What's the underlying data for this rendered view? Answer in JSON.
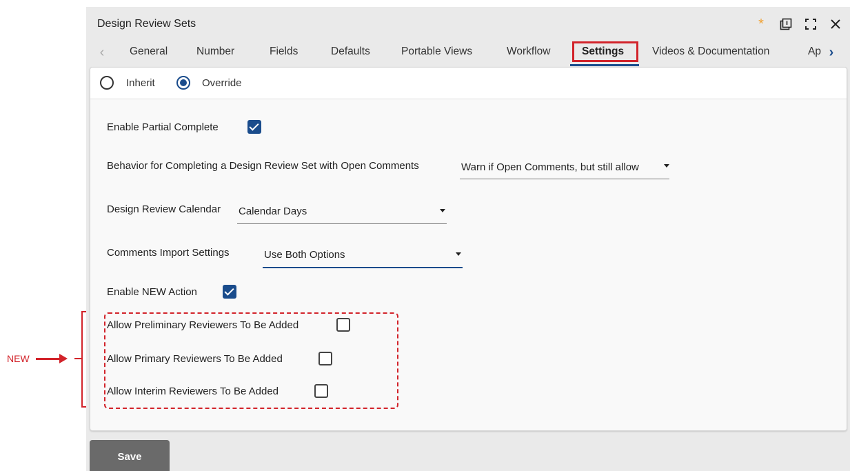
{
  "window": {
    "title": "Design Review Sets",
    "icons": [
      "asterisk-icon",
      "popout-icon",
      "fullscreen-icon",
      "close-icon"
    ]
  },
  "tabs": [
    {
      "label": "General"
    },
    {
      "label": "Number"
    },
    {
      "label": "Fields"
    },
    {
      "label": "Defaults"
    },
    {
      "label": "Portable Views"
    },
    {
      "label": "Workflow"
    },
    {
      "label": "Settings",
      "active": true
    },
    {
      "label": "Videos & Documentation"
    },
    {
      "label": "Ap"
    }
  ],
  "mode": {
    "inherit_label": "Inherit",
    "override_label": "Override",
    "selected": "Override"
  },
  "settings": {
    "enable_partial_complete": {
      "label": "Enable Partial Complete",
      "checked": true
    },
    "open_comments_behavior": {
      "label": "Behavior for Completing a Design Review Set with Open Comments",
      "value": "Warn if Open Comments, but still allow"
    },
    "review_calendar": {
      "label": "Design Review Calendar",
      "value": "Calendar Days"
    },
    "comments_import": {
      "label": "Comments Import Settings",
      "value": "Use Both Options"
    },
    "enable_new_action": {
      "label": "Enable NEW Action",
      "checked": true
    },
    "allow_preliminary": {
      "label": "Allow Preliminary Reviewers To Be Added",
      "checked": false
    },
    "allow_primary": {
      "label": "Allow Primary Reviewers To Be Added",
      "checked": false
    },
    "allow_interim": {
      "label": "Allow Interim Reviewers To Be Added",
      "checked": false
    }
  },
  "actions": {
    "save_label": "Save"
  },
  "annotation": {
    "label": "NEW",
    "color": "#d2232a"
  },
  "colors": {
    "accent": "#1a4c8c",
    "highlight": "#d2232a",
    "unsaved": "#f0a030"
  }
}
